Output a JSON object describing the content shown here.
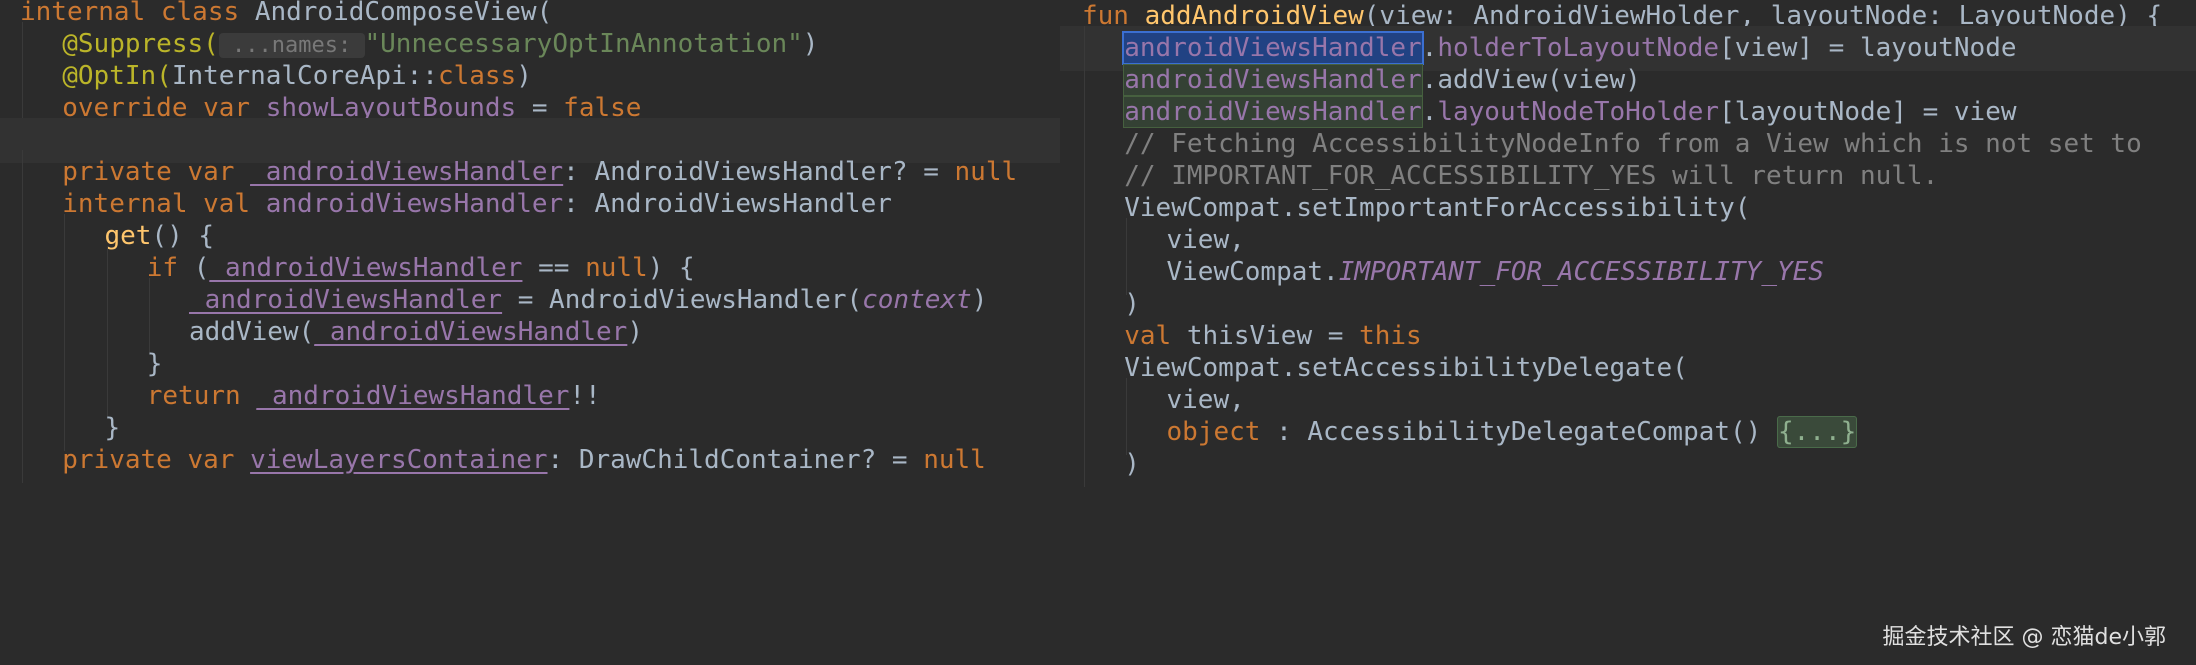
{
  "left_pane": {
    "lines": [
      {
        "indent": 0,
        "tokens": [
          {
            "t": "internal class ",
            "c": "kw"
          },
          {
            "t": "AndroidComposeView(",
            "c": "plain"
          }
        ]
      },
      {
        "indent": 2,
        "tokens": [
          {
            "t": "@Suppress(",
            "c": "anno"
          },
          {
            "t": " ...names: ",
            "c": "hint"
          },
          {
            "t": "\"UnnecessaryOptInAnnotation\"",
            "c": "str"
          },
          {
            "t": ")",
            "c": "plain"
          }
        ]
      },
      {
        "indent": 2,
        "tokens": [
          {
            "t": "@OptIn(",
            "c": "anno"
          },
          {
            "t": "InternalCoreApi::",
            "c": "plain"
          },
          {
            "t": "class",
            "c": "kw"
          },
          {
            "t": ")",
            "c": "plain"
          }
        ]
      },
      {
        "indent": 2,
        "tokens": [
          {
            "t": "override var ",
            "c": "kw"
          },
          {
            "t": "showLayoutBounds",
            "c": "propu"
          },
          {
            "t": " = ",
            "c": "plain"
          },
          {
            "t": "false",
            "c": "kw"
          }
        ]
      },
      {
        "indent": 0,
        "cur": true,
        "tokens": []
      },
      {
        "indent": 2,
        "tokens": [
          {
            "t": "private var ",
            "c": "kw"
          },
          {
            "t": "_androidViewsHandler",
            "c": "propu"
          },
          {
            "t": ": AndroidViewsHandler? = ",
            "c": "plain"
          },
          {
            "t": "null",
            "c": "kw"
          }
        ]
      },
      {
        "indent": 2,
        "tokens": [
          {
            "t": "internal val ",
            "c": "kw"
          },
          {
            "t": "androidViewsHandler",
            "c": "prop"
          },
          {
            "t": ": AndroidViewsHandler",
            "c": "plain"
          }
        ]
      },
      {
        "indent": 4,
        "tokens": [
          {
            "t": "get",
            "c": "fn"
          },
          {
            "t": "() {",
            "c": "plain"
          }
        ]
      },
      {
        "indent": 6,
        "tokens": [
          {
            "t": "if ",
            "c": "kw"
          },
          {
            "t": "(",
            "c": "plain"
          },
          {
            "t": "_androidViewsHandler",
            "c": "propu"
          },
          {
            "t": " == ",
            "c": "plain"
          },
          {
            "t": "null",
            "c": "kw"
          },
          {
            "t": ") {",
            "c": "plain"
          }
        ]
      },
      {
        "indent": 8,
        "tokens": [
          {
            "t": "_androidViewsHandler",
            "c": "propu"
          },
          {
            "t": " = AndroidViewsHandler(",
            "c": "plain"
          },
          {
            "t": "context",
            "c": "ital"
          },
          {
            "t": ")",
            "c": "plain"
          }
        ]
      },
      {
        "indent": 8,
        "tokens": [
          {
            "t": "addView(",
            "c": "plain"
          },
          {
            "t": "_androidViewsHandler",
            "c": "propu"
          },
          {
            "t": ")",
            "c": "plain"
          }
        ]
      },
      {
        "indent": 6,
        "tokens": [
          {
            "t": "}",
            "c": "plain"
          }
        ]
      },
      {
        "indent": 6,
        "tokens": [
          {
            "t": "return ",
            "c": "kw"
          },
          {
            "t": "_androidViewsHandler",
            "c": "propu"
          },
          {
            "t": "!!",
            "c": "plain"
          }
        ]
      },
      {
        "indent": 4,
        "tokens": [
          {
            "t": "}",
            "c": "plain"
          }
        ]
      },
      {
        "indent": 2,
        "tokens": [
          {
            "t": "private var ",
            "c": "kw"
          },
          {
            "t": "viewLayersContainer",
            "c": "propu"
          },
          {
            "t": ": DrawChildContainer? = ",
            "c": "plain"
          },
          {
            "t": "null",
            "c": "kw"
          }
        ]
      }
    ]
  },
  "right_pane": {
    "lines": [
      {
        "indent": 0,
        "tokens": [
          {
            "t": "fun ",
            "c": "kw"
          },
          {
            "t": "addAndroidView",
            "c": "fn"
          },
          {
            "t": "(view: AndroidViewHolder, layoutNode: LayoutNode) {",
            "c": "plain"
          }
        ]
      },
      {
        "indent": 2,
        "cur": true,
        "tokens": [
          {
            "t": "androidViewsHandler",
            "c": "hi-blue"
          },
          {
            "t": ".",
            "c": "plain"
          },
          {
            "t": "holderToLayoutNode",
            "c": "prop"
          },
          {
            "t": "[view] = layoutNode",
            "c": "plain"
          }
        ]
      },
      {
        "indent": 2,
        "tokens": [
          {
            "t": "androidViewsHandler",
            "c": "hi-green"
          },
          {
            "t": ".addView(view)",
            "c": "plain"
          }
        ]
      },
      {
        "indent": 2,
        "tokens": [
          {
            "t": "androidViewsHandler",
            "c": "hi-green"
          },
          {
            "t": ".",
            "c": "plain"
          },
          {
            "t": "layoutNodeToHolder",
            "c": "prop"
          },
          {
            "t": "[layoutNode] = view",
            "c": "plain"
          }
        ]
      },
      {
        "indent": 2,
        "tokens": [
          {
            "t": "// Fetching AccessibilityNodeInfo from a View which is not set to",
            "c": "com"
          }
        ]
      },
      {
        "indent": 2,
        "tokens": [
          {
            "t": "// IMPORTANT_FOR_ACCESSIBILITY_YES will return null.",
            "c": "com"
          }
        ]
      },
      {
        "indent": 2,
        "tokens": [
          {
            "t": "ViewCompat.setImportantForAccessibility(",
            "c": "plain"
          }
        ]
      },
      {
        "indent": 4,
        "tokens": [
          {
            "t": "view,",
            "c": "plain"
          }
        ]
      },
      {
        "indent": 4,
        "tokens": [
          {
            "t": "ViewCompat.",
            "c": "plain"
          },
          {
            "t": "IMPORTANT_FOR_ACCESSIBILITY_YES",
            "c": "ital"
          }
        ]
      },
      {
        "indent": 2,
        "tokens": [
          {
            "t": ")",
            "c": "plain"
          }
        ]
      },
      {
        "indent": 2,
        "tokens": [
          {
            "t": "val ",
            "c": "kw"
          },
          {
            "t": "thisView = ",
            "c": "plain"
          },
          {
            "t": "this",
            "c": "kw"
          }
        ]
      },
      {
        "indent": 2,
        "tokens": [
          {
            "t": "ViewCompat.setAccessibilityDelegate(",
            "c": "plain"
          }
        ]
      },
      {
        "indent": 4,
        "tokens": [
          {
            "t": "view,",
            "c": "plain"
          }
        ]
      },
      {
        "indent": 4,
        "tokens": [
          {
            "t": "object ",
            "c": "kw"
          },
          {
            "t": ": AccessibilityDelegateCompat() ",
            "c": "plain"
          },
          {
            "t": "{...}",
            "c": "fold"
          }
        ]
      },
      {
        "indent": 2,
        "tokens": [
          {
            "t": ")",
            "c": "plain"
          }
        ]
      }
    ]
  },
  "watermark": "掘金技术社区 @ 恋猫de小郭",
  "colors": {
    "background": "#2b2b2b",
    "keyword": "#cc7832",
    "function": "#ffc66d",
    "string": "#6a8759",
    "property": "#9876aa",
    "annotation": "#bbb529",
    "comment": "#808080",
    "plain": "#a9b7c6",
    "selection_blue": "#214283",
    "usage_green": "#344134"
  }
}
